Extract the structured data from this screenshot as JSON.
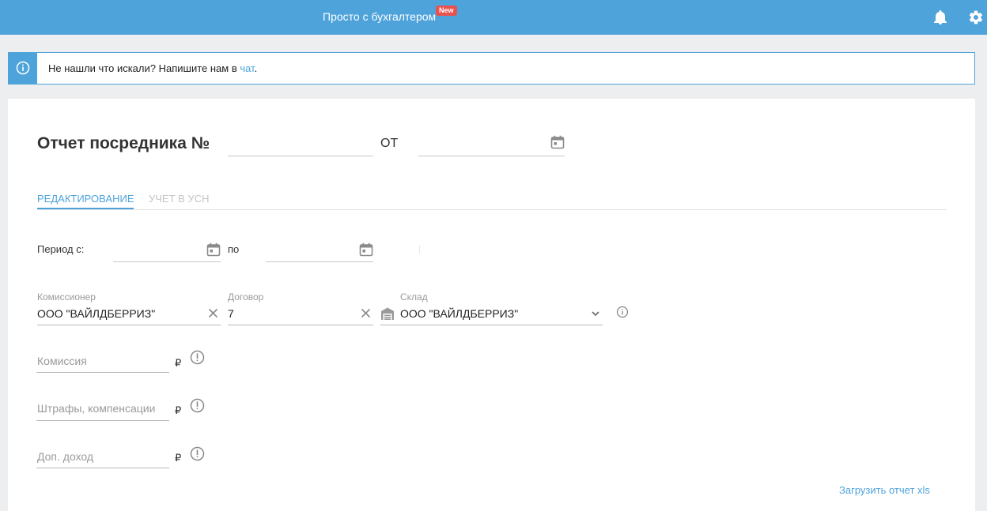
{
  "header": {
    "brand": "Просто с бухгалтером",
    "new_badge": "New"
  },
  "notice": {
    "text_before": "Не нашли что искали? Напишите нам в ",
    "link": "чат",
    "text_after": "."
  },
  "form": {
    "title": "Отчет посредника №",
    "number_value": "",
    "ot_label": "ОТ",
    "date_value": "",
    "tabs": [
      {
        "label": "РЕДАКТИРОВАНИЕ",
        "active": true
      },
      {
        "label": "УЧЕТ В УСН",
        "active": false
      }
    ],
    "period": {
      "from_label": "Период с:",
      "to_label": "по"
    },
    "commissioner": {
      "label": "Комиссионер",
      "value": "ООО \"ВАЙЛДБЕРРИЗ\""
    },
    "contract": {
      "label": "Договор",
      "value": "7"
    },
    "warehouse": {
      "label": "Склад",
      "value": "ООО \"ВАЙЛДБЕРРИЗ\""
    },
    "commission": {
      "placeholder": "Комиссия",
      "currency": "₽"
    },
    "fines": {
      "placeholder": "Штрафы, компенсации",
      "currency": "₽"
    },
    "extra_income": {
      "placeholder": "Доп. доход",
      "currency": "₽"
    },
    "upload_link": "Загрузить отчет xls"
  },
  "colors": {
    "accent": "#4fa3db",
    "badge": "#e8534f",
    "background": "#eceef0"
  }
}
